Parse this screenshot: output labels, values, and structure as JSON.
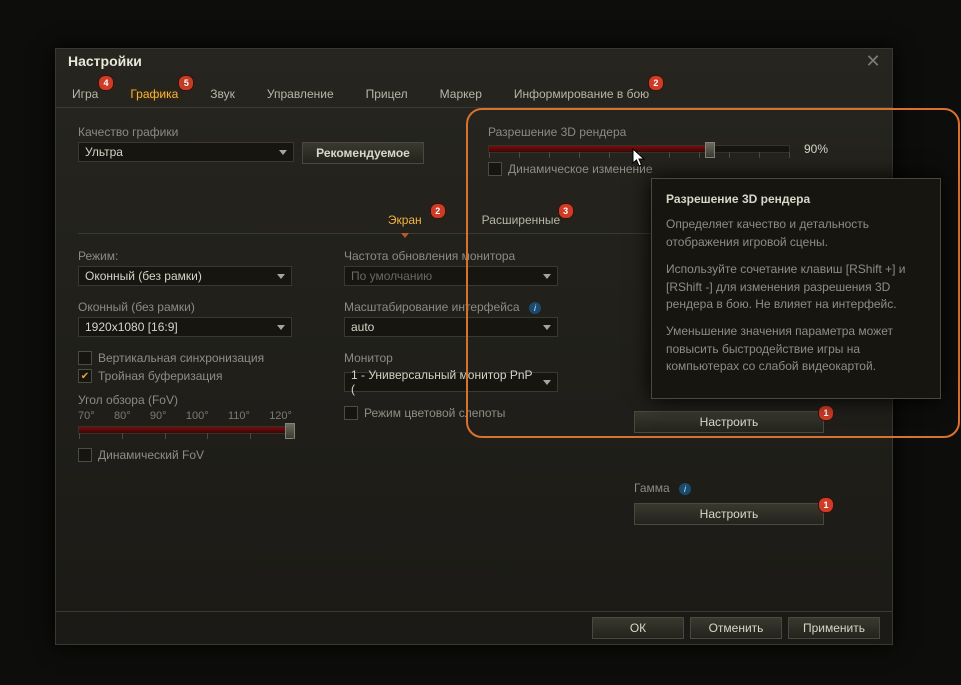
{
  "window": {
    "title": "Настройки"
  },
  "tabs": [
    {
      "label": "Игра",
      "badge": "4"
    },
    {
      "label": "Графика",
      "badge": "5",
      "active": true
    },
    {
      "label": "Звук"
    },
    {
      "label": "Управление"
    },
    {
      "label": "Прицел"
    },
    {
      "label": "Маркер"
    },
    {
      "label": "Информирование в бою",
      "badge": "2"
    }
  ],
  "quality": {
    "label": "Качество графики",
    "value": "Ультра",
    "recommended_btn": "Рекомендуемое"
  },
  "render3d": {
    "label": "Разрешение 3D рендера",
    "percent_text": "90%",
    "percent": 90,
    "dynamic_check": "Динамическое изменение"
  },
  "subtabs": {
    "screen": "Экран",
    "screen_badge": "2",
    "advanced": "Расширенные",
    "advanced_badge": "3"
  },
  "screen": {
    "mode_label": "Режим:",
    "mode_value": "Оконный (без рамки)",
    "res_label": "Оконный (без рамки)",
    "res_value": "1920x1080 [16:9]",
    "vsync": "Вертикальная синхронизация",
    "triple_buf": "Тройная буферизация",
    "fov_label": "Угол обзора (FoV)",
    "fov_ticks": [
      "70°",
      "80°",
      "90°",
      "100°",
      "110°",
      "120°"
    ],
    "fov_value": 120,
    "dynamic_fov": "Динамический FoV",
    "refresh_label": "Частота обновления монитора",
    "refresh_value": "По умолчанию",
    "scaling_label": "Масштабирование интерфейса",
    "scaling_value": "auto",
    "monitor_label": "Монитор",
    "monitor_value": "1 - Универсальный монитор PnP (",
    "colorblind": "Режим цветовой слепоты",
    "configure_btn": "Настроить",
    "gamma_label": "Гамма"
  },
  "tooltip": {
    "title": "Разрешение 3D рендера",
    "p1": "Определяет качество и детальность отображения игровой сцены.",
    "p2": "Используйте сочетание клавиш [RShift +] и [RShift -] для изменения разрешения 3D рендера в бою. Не влияет на интерфейс.",
    "p3": "Уменьшение значения параметра может повысить быстродействие игры на компьютерах со слабой видеокартой."
  },
  "footer": {
    "ok": "ОК",
    "cancel": "Отменить",
    "apply": "Применить"
  },
  "badges": {
    "configure1": "1",
    "configure2": "1"
  }
}
